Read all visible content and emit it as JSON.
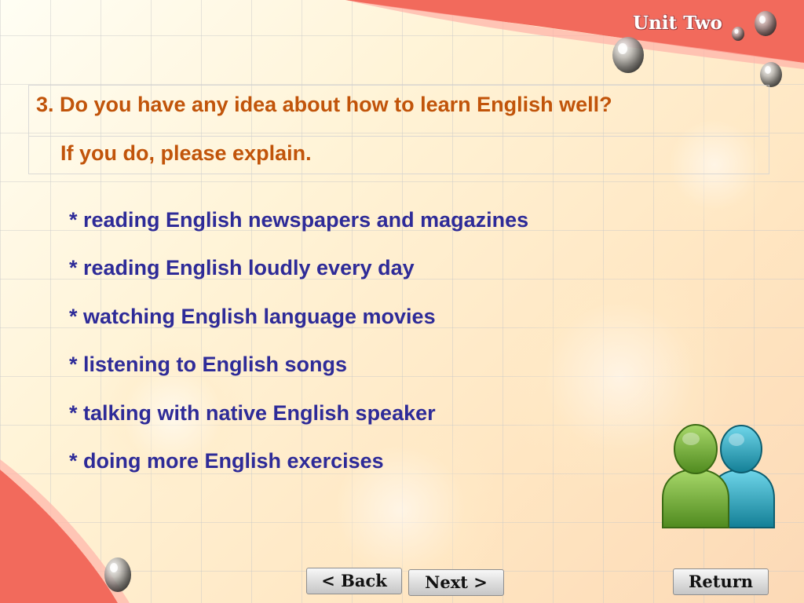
{
  "header": {
    "unit_title": "Unit Two"
  },
  "question": {
    "line1": "3. Do you have any idea about how to learn English well?",
    "line2": "If you do, please explain."
  },
  "answers": [
    "* reading English newspapers and magazines",
    "* reading English loudly every day",
    "* watching English language movies",
    "* listening to English songs",
    "* talking with native English speaker",
    "* doing more English exercises"
  ],
  "navigation": {
    "back_label": "< Back",
    "next_label": "Next >",
    "return_label": "Return"
  },
  "icons": {
    "users": "users-icon",
    "water_drops": "water-drop-icon"
  },
  "colors": {
    "question_text": "#c1540a",
    "answer_text": "#2e2b98",
    "ribbon": "#f26a5c",
    "user_front": "#6fa52c",
    "user_back": "#1e9bb3"
  }
}
